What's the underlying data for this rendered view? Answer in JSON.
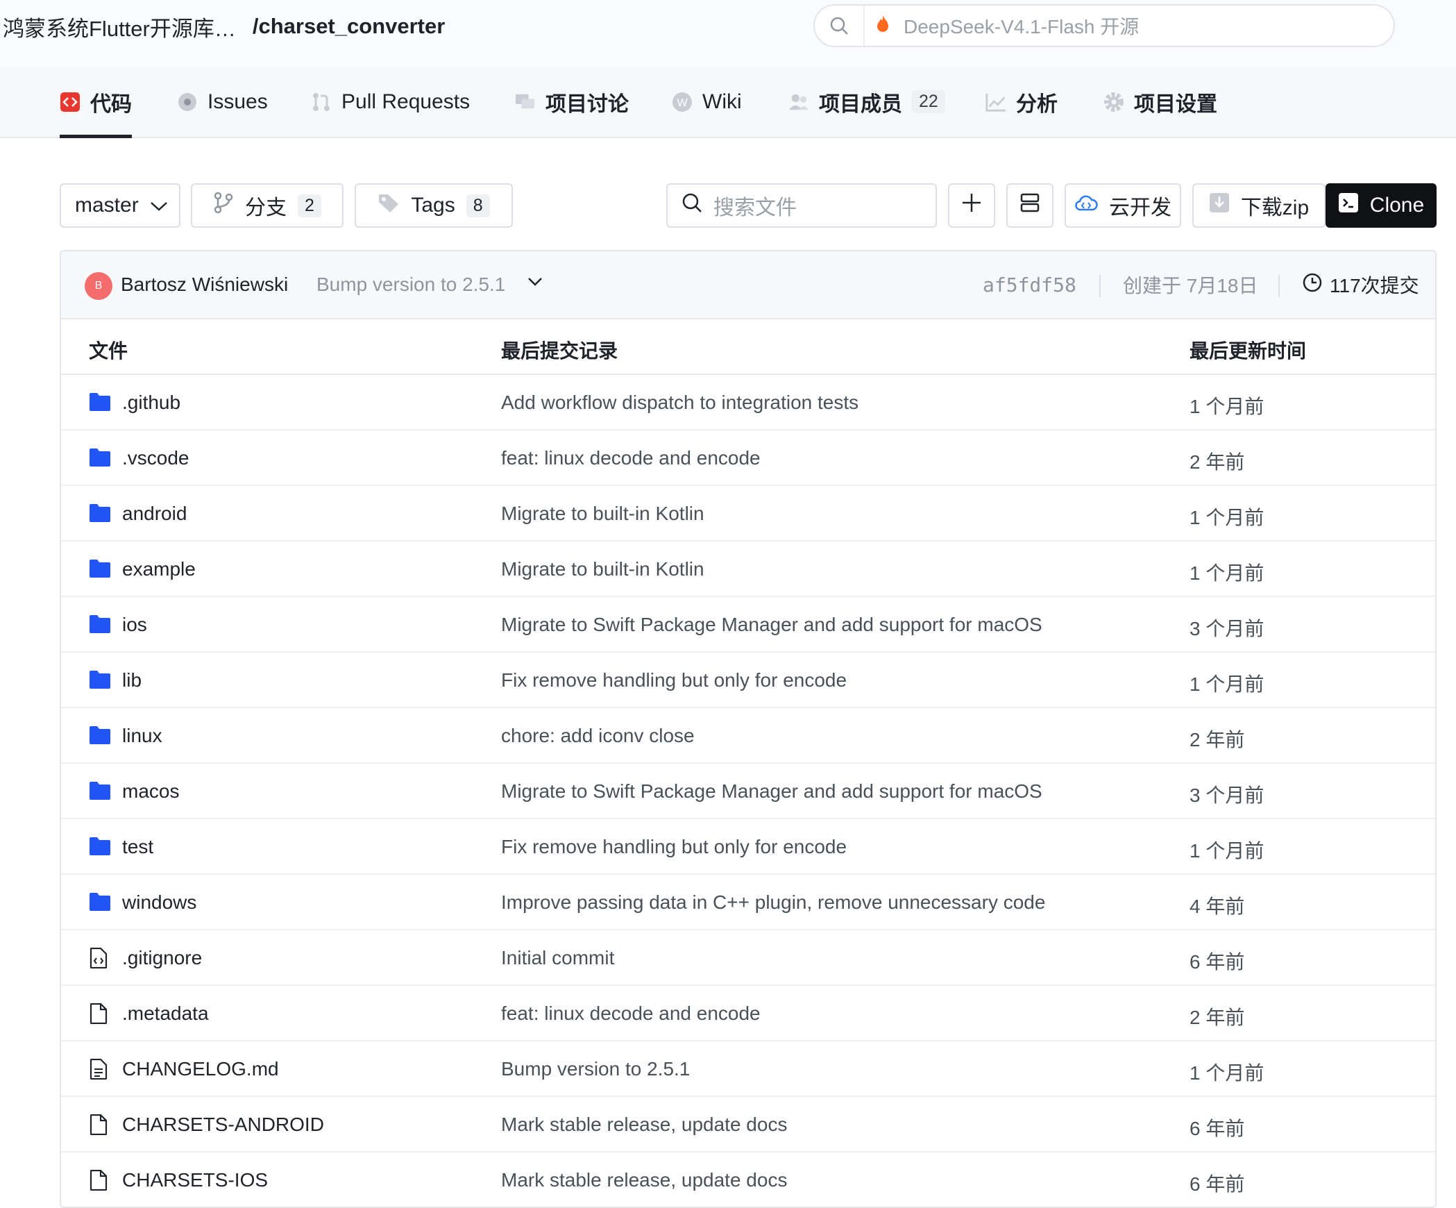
{
  "header": {
    "org": "鸿蒙系统Flutter开源库…",
    "repo": "/charset_converter",
    "search_placeholder": "DeepSeek-V4.1-Flash 开源"
  },
  "tabs": [
    {
      "label": "代码",
      "icon": "code-icon"
    },
    {
      "label": "Issues",
      "icon": "issues-icon"
    },
    {
      "label": "Pull Requests",
      "icon": "pull-request-icon"
    },
    {
      "label": "项目讨论",
      "icon": "discussion-icon"
    },
    {
      "label": "Wiki",
      "icon": "wiki-icon"
    },
    {
      "label": "项目成员",
      "icon": "members-icon",
      "badge": "22"
    },
    {
      "label": "分析",
      "icon": "analytics-icon"
    },
    {
      "label": "项目设置",
      "icon": "settings-icon"
    }
  ],
  "toolbar": {
    "branch": "master",
    "branches_label": "分支",
    "branches_count": "2",
    "tags_label": "Tags",
    "tags_count": "8",
    "search_placeholder": "搜索文件",
    "cloud_label": "云开发",
    "download_label": "下载zip",
    "clone_label": "Clone"
  },
  "commit": {
    "avatar_letter": "B",
    "author": "Bartosz Wiśniewski",
    "message": "Bump version to 2.5.1",
    "hash": "af5fdf58",
    "created": "创建于 7月18日",
    "commits": "117次提交"
  },
  "table": {
    "headers": {
      "file": "文件",
      "commit": "最后提交记录",
      "time": "最后更新时间"
    },
    "rows": [
      {
        "name": ".github",
        "type": "folder",
        "message": "Add workflow dispatch to integration tests",
        "time": "1 个月前"
      },
      {
        "name": ".vscode",
        "type": "folder",
        "message": "feat: linux decode and encode",
        "time": "2 年前"
      },
      {
        "name": "android",
        "type": "folder",
        "message": "Migrate to built-in Kotlin",
        "time": "1 个月前"
      },
      {
        "name": "example",
        "type": "folder",
        "message": "Migrate to built-in Kotlin",
        "time": "1 个月前"
      },
      {
        "name": "ios",
        "type": "folder",
        "message": "Migrate to Swift Package Manager and add support for macOS",
        "time": "3 个月前"
      },
      {
        "name": "lib",
        "type": "folder",
        "message": "Fix remove handling but only for encode",
        "time": "1 个月前"
      },
      {
        "name": "linux",
        "type": "folder",
        "message": "chore: add iconv close",
        "time": "2 年前"
      },
      {
        "name": "macos",
        "type": "folder",
        "message": "Migrate to Swift Package Manager and add support for macOS",
        "time": "3 个月前"
      },
      {
        "name": "test",
        "type": "folder",
        "message": "Fix remove handling but only for encode",
        "time": "1 个月前"
      },
      {
        "name": "windows",
        "type": "folder",
        "message": "Improve passing data in C++ plugin, remove unnecessary code",
        "time": "4 年前"
      },
      {
        "name": ".gitignore",
        "type": "code-file",
        "message": "Initial commit",
        "time": "6 年前"
      },
      {
        "name": ".metadata",
        "type": "file",
        "message": "feat: linux decode and encode",
        "time": "2 年前"
      },
      {
        "name": "CHANGELOG.md",
        "type": "text-file",
        "message": "Bump version to 2.5.1",
        "time": "1 个月前"
      },
      {
        "name": "CHARSETS-ANDROID",
        "type": "file",
        "message": "Mark stable release, update docs",
        "time": "6 年前"
      },
      {
        "name": "CHARSETS-IOS",
        "type": "file",
        "message": "Mark stable release, update docs",
        "time": "6 年前"
      }
    ]
  },
  "colors": {
    "folder": "#2155f5",
    "accent_dark": "#0f1115",
    "code_tab": "#e8372f"
  }
}
